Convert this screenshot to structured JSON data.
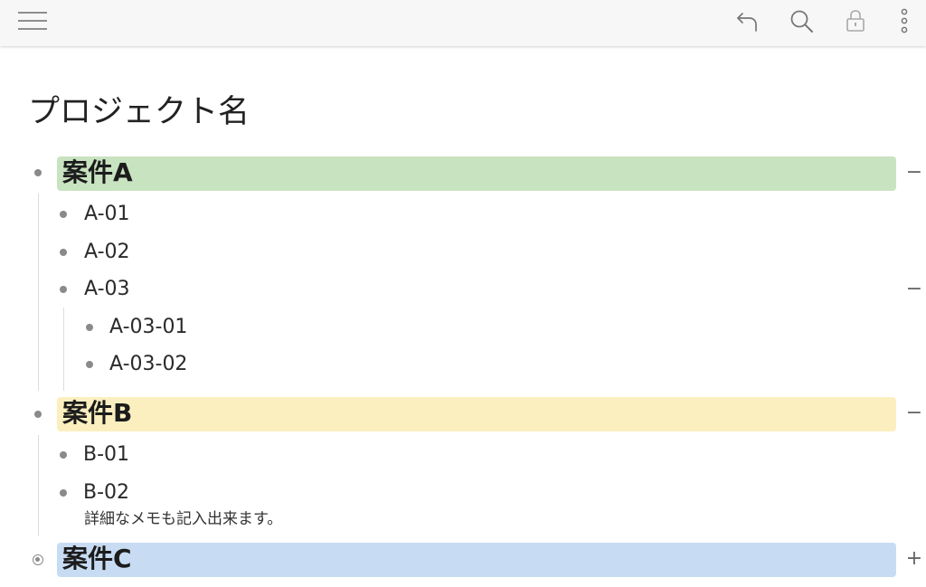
{
  "toolbar": {
    "menu_icon": "hamburger-menu-icon",
    "undo_icon": "undo-arrow-icon",
    "search_icon": "search-icon",
    "lock_icon": "lock-icon",
    "more_icon": "vertical-dots-icon"
  },
  "page": {
    "title": "プロジェクト名"
  },
  "outline": {
    "items": [
      {
        "label": "案件A",
        "highlight": "#c8e3c0",
        "expanded": true,
        "toggle": "−",
        "children": [
          {
            "label": "A-01"
          },
          {
            "label": "A-02"
          },
          {
            "label": "A-03",
            "expanded": true,
            "toggle": "−",
            "children": [
              {
                "label": "A-03-01"
              },
              {
                "label": "A-03-02"
              }
            ]
          }
        ]
      },
      {
        "label": "案件B",
        "highlight": "#fcefbf",
        "expanded": true,
        "toggle": "−",
        "children": [
          {
            "label": "B-01"
          },
          {
            "label": "B-02",
            "note": "詳細なメモも記入出来ます。"
          }
        ]
      },
      {
        "label": "案件C",
        "highlight": "#c7dcf3",
        "expanded": false,
        "toggle": "+"
      }
    ]
  }
}
